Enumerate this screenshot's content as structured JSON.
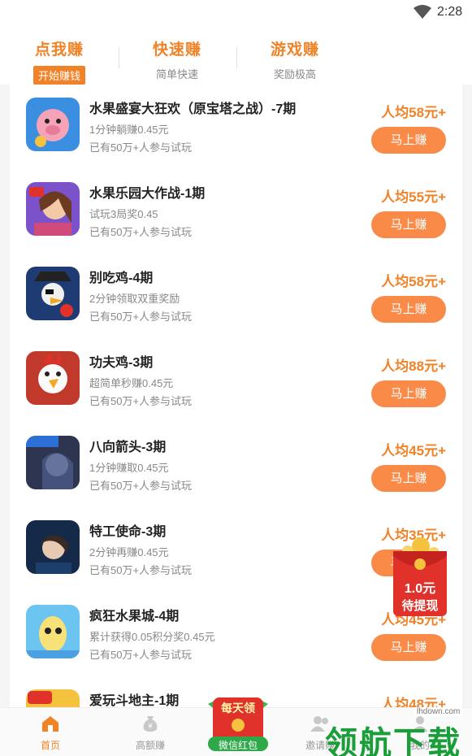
{
  "status_bar": {
    "time": "2:28"
  },
  "top_tabs": [
    {
      "title": "点我赚",
      "subtitle": "开始赚钱"
    },
    {
      "title": "快速赚",
      "subtitle": "简单快速"
    },
    {
      "title": "游戏赚",
      "subtitle": "奖励极高"
    }
  ],
  "items": [
    {
      "title": "水果盛宴大狂欢（原宝塔之战）-7期",
      "line1": "1分钟躺赚0.45元",
      "line2": "已有50万+人参与试玩",
      "reward": "人均58元+",
      "button": "马上赚"
    },
    {
      "title": "水果乐园大作战-1期",
      "line1": "试玩3局奖0.45",
      "line2": "已有50万+人参与试玩",
      "reward": "人均55元+",
      "button": "马上赚"
    },
    {
      "title": "别吃鸡-4期",
      "line1": "2分钟领取双重奖励",
      "line2": "已有50万+人参与试玩",
      "reward": "人均58元+",
      "button": "马上赚"
    },
    {
      "title": "功夫鸡-3期",
      "line1": "超简单秒赚0.45元",
      "line2": "已有50万+人参与试玩",
      "reward": "人均88元+",
      "button": "马上赚"
    },
    {
      "title": "八向箭头-3期",
      "line1": "1分钟赚取0.45元",
      "line2": "已有50万+人参与试玩",
      "reward": "人均45元+",
      "button": "马上赚"
    },
    {
      "title": "特工使命-3期",
      "line1": "2分钟再赚0.45元",
      "line2": "已有50万+人参与试玩",
      "reward": "人均35元+",
      "button": "马上赚"
    },
    {
      "title": "疯狂水果城-4期",
      "line1": "累计获得0.05积分奖0.45元",
      "line2": "已有50万+人参与试玩",
      "reward": "人均45元+",
      "button": "马上赚"
    },
    {
      "title": "爱玩斗地主-1期",
      "line1": "",
      "line2": "",
      "reward": "人均48元+",
      "button": ""
    }
  ],
  "floating_redpacket": {
    "amount": "1.0元",
    "label": "待提现"
  },
  "center_redpacket": {
    "top_text": "每天领",
    "label": "微信红包"
  },
  "bottom_nav": [
    {
      "label": "首页"
    },
    {
      "label": "高额赚"
    },
    {
      "label": "邀请赚"
    },
    {
      "label": "我的"
    }
  ],
  "watermark": {
    "text": "领航下载",
    "url": "lhdown.com"
  },
  "colors": {
    "accent": "#f08227",
    "button": "#f98a47",
    "red": "#e0322a"
  }
}
